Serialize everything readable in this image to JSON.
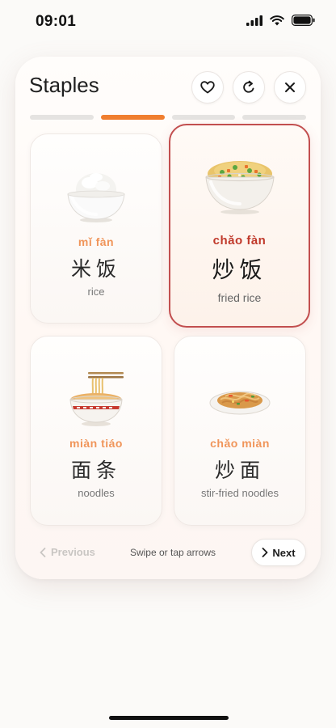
{
  "status": {
    "time": "09:01"
  },
  "header": {
    "title": "Staples"
  },
  "icons": {
    "favorite": "heart-icon",
    "refresh": "refresh-icon",
    "close": "close-icon",
    "prev": "chevron-left-icon",
    "next": "chevron-right-icon"
  },
  "progress": {
    "total_segments": 4,
    "current_segment": 2
  },
  "cards": [
    {
      "pinyin": "mǐ  fàn",
      "hanzi": "米饭",
      "meaning": "rice",
      "selected": false
    },
    {
      "pinyin": "chǎo  fàn",
      "hanzi": "炒饭",
      "meaning": "fried rice",
      "selected": true
    },
    {
      "pinyin": "miàn tiáo",
      "hanzi": "面条",
      "meaning": "noodles",
      "selected": false
    },
    {
      "pinyin": "chǎo miàn",
      "hanzi": "炒面",
      "meaning": "stir-fried noodles",
      "selected": false
    }
  ],
  "footer": {
    "previous_label": "Previous",
    "hint": "Swipe or tap arrows",
    "next_label": "Next"
  },
  "colors": {
    "accent": "#f07e2f",
    "selected_border": "#c24f4f",
    "pinyin": "#f0955a",
    "selected_pinyin": "#c0392b"
  }
}
